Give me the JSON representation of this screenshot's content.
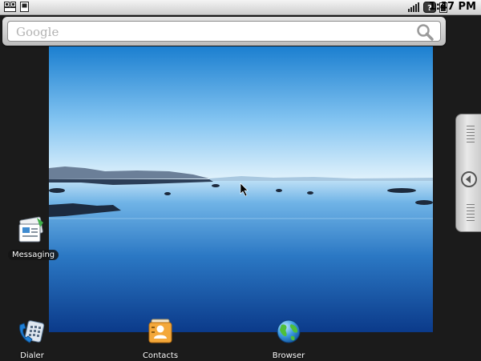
{
  "status_bar": {
    "time": "1:47 PM",
    "icons": [
      "notification-icon",
      "sim-card-icon",
      "signal-icon",
      "no-sim-alert-icon",
      "battery-icon"
    ]
  },
  "search": {
    "placeholder": "Google",
    "icon": "search-icon"
  },
  "apps": {
    "messaging": "Messaging",
    "dialer": "Dialer",
    "contacts": "Contacts",
    "browser": "Browser"
  },
  "drawer_handle": {
    "icon": "chevron-left-icon"
  }
}
